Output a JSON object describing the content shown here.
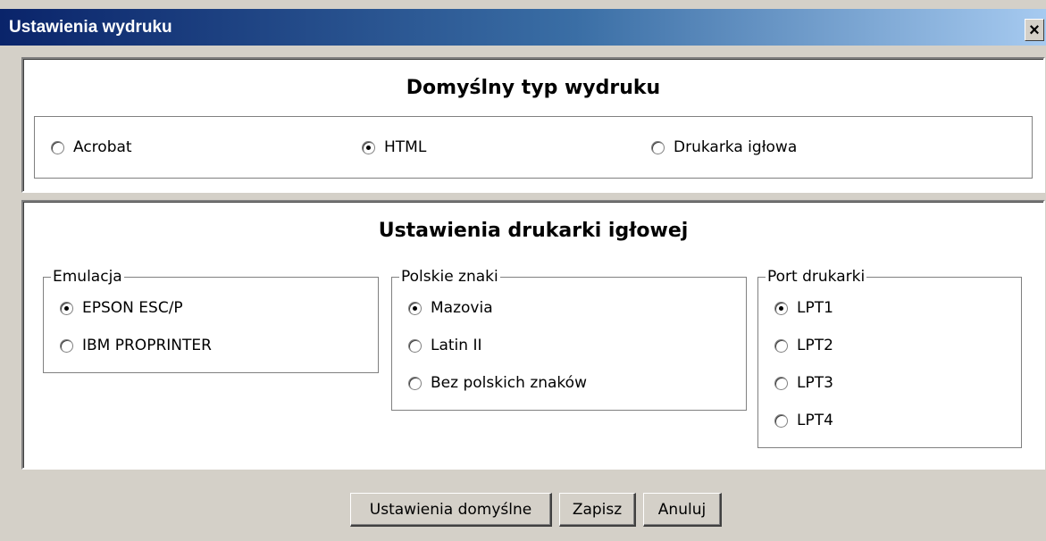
{
  "window": {
    "title": "Ustawienia wydruku",
    "close_label": "×"
  },
  "print_type": {
    "title": "Domyślny typ wydruku",
    "options": [
      {
        "label": "Acrobat",
        "checked": false
      },
      {
        "label": "HTML",
        "checked": true
      },
      {
        "label": "Drukarka igłowa",
        "checked": false
      }
    ]
  },
  "dot_matrix": {
    "title": "Ustawienia drukarki igłowej",
    "emulation": {
      "legend": "Emulacja",
      "options": [
        {
          "label": "EPSON ESC/P",
          "checked": true
        },
        {
          "label": "IBM PROPRINTER",
          "checked": false
        }
      ]
    },
    "polish_chars": {
      "legend": "Polskie znaki",
      "options": [
        {
          "label": "Mazovia",
          "checked": true
        },
        {
          "label": "Latin II",
          "checked": false
        },
        {
          "label": "Bez polskich znaków",
          "checked": false
        }
      ]
    },
    "port": {
      "legend": "Port drukarki",
      "options": [
        {
          "label": "LPT1",
          "checked": true
        },
        {
          "label": "LPT2",
          "checked": false
        },
        {
          "label": "LPT3",
          "checked": false
        },
        {
          "label": "LPT4",
          "checked": false
        }
      ]
    }
  },
  "buttons": {
    "defaults": "Ustawienia domyślne",
    "save": "Zapisz",
    "cancel": "Anuluj"
  }
}
